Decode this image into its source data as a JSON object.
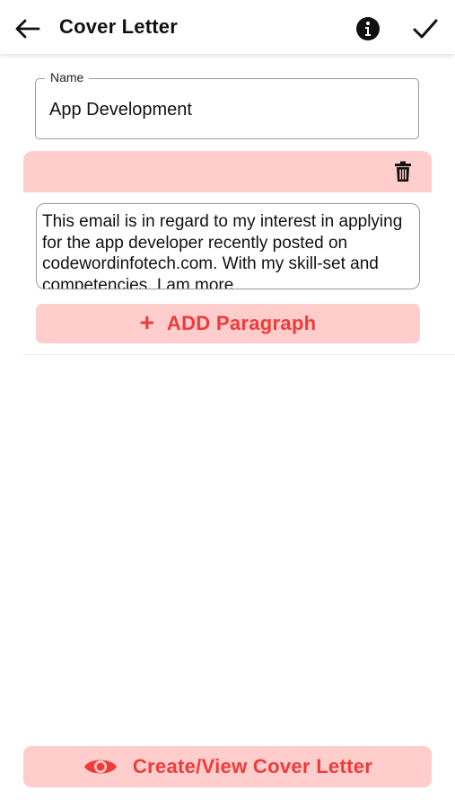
{
  "app_bar": {
    "title": "Cover Letter"
  },
  "name_field": {
    "label": "Name",
    "value": "App Development"
  },
  "paragraph": {
    "text": "This email is in regard to my interest in applying for the app developer recently posted on codewordinfotech.com. With my skill-set and competencies, I am more"
  },
  "add_paragraph": {
    "icon": "+",
    "label": "ADD Paragraph"
  },
  "create_view": {
    "label": "Create/View Cover Letter"
  },
  "colors": {
    "accent": "#f13a3a",
    "accent_bg": "#ffcdcc"
  },
  "icons": {
    "back": "arrow-left-icon",
    "info": "info-icon",
    "confirm": "check-icon",
    "delete": "trash-icon",
    "view": "eye-icon"
  }
}
